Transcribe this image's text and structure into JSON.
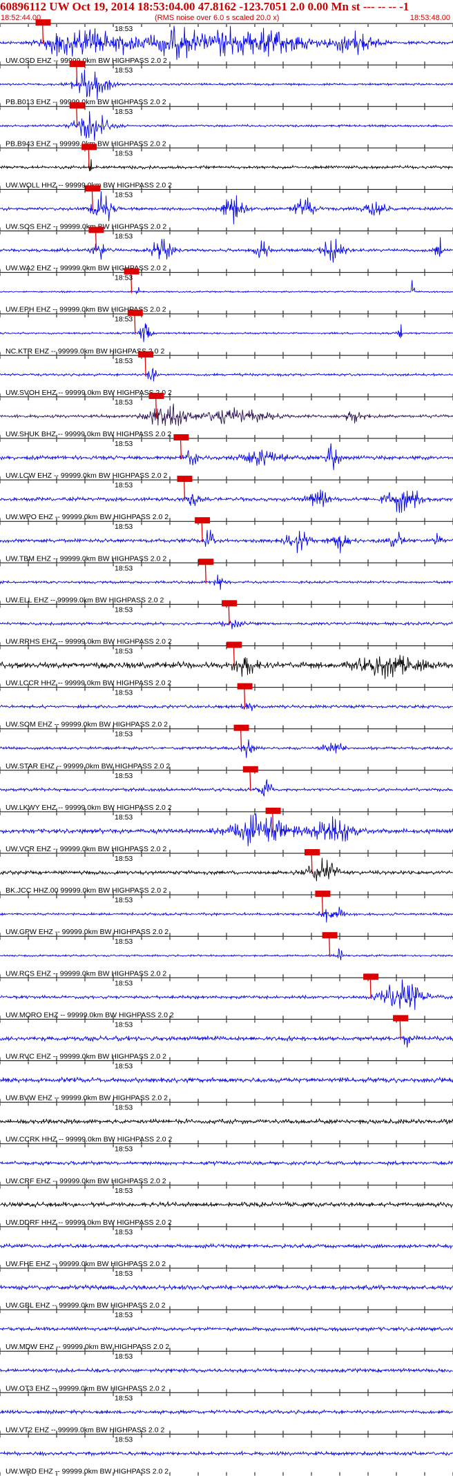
{
  "header": {
    "title": "60896112 UW Oct 19, 2014 18:53:04.00   47.8162 -123.7051  2.0 0.00 Mn st --- -- --   -1",
    "start_time": "18:52:44.00",
    "rms_note": "(RMS noise over 6.0 s scaled 20.0 x)",
    "end_time": "18:53:48.00"
  },
  "chart_data": {
    "type": "line",
    "x_start": "18:52:44.00",
    "x_end": "18:53:48.00",
    "x_range_seconds": [
      0,
      64
    ],
    "minute_tick_label": "18:53",
    "minute_tick_seconds": 16,
    "tick_interval_seconds": 4,
    "station_suffix": "99999.0km BW  HIGHPASS  2.0  2",
    "traces": [
      {
        "label": "UW.OSD EHZ -- 99999.0km BW  HIGHPASS  2.0  2",
        "color": "#0000ee",
        "pick_s": 6.0,
        "events": [
          [
            10,
            8,
            1.0
          ],
          [
            15,
            8,
            0.9
          ],
          [
            25,
            10,
            0.9
          ],
          [
            32,
            4,
            0.7
          ],
          [
            38,
            12,
            0.8
          ],
          [
            50,
            6,
            0.7
          ]
        ],
        "noise": 0.1
      },
      {
        "label": "PB.B013 EHZ -- 99999.0km BW  HIGHPASS  2.0  2",
        "color": "#0000ee",
        "pick_s": 10.8,
        "events": [
          [
            13,
            5,
            1.0
          ]
        ],
        "noise": 0.07
      },
      {
        "label": "PB.B943 EHZ -- 99999.0km BW  HIGHPASS  2.0  2",
        "color": "#0000ee",
        "pick_s": 10.8,
        "events": [
          [
            13,
            5,
            1.0
          ]
        ],
        "noise": 0.07
      },
      {
        "label": "UW.WOLL HHZ -- 99999.0km BW  HIGHPASS  2.0  2",
        "color": "#000000",
        "pick_s": 12.5,
        "events": [
          [
            12.7,
            0.6,
            0.6
          ]
        ],
        "noise": 0.1
      },
      {
        "label": "UW.SOS EHZ -- 99999.0km BW  HIGHPASS  2.0  2",
        "color": "#0000ee",
        "pick_s": 13.0,
        "events": [
          [
            14.5,
            3,
            0.9
          ],
          [
            33,
            3,
            0.9
          ],
          [
            43,
            3,
            0.8
          ],
          [
            53,
            3,
            0.6
          ]
        ],
        "noise": 0.1
      },
      {
        "label": "UW.WA2 EHZ -- 99999.0km BW  HIGHPASS  2.0  2",
        "color": "#0000ee",
        "pick_s": 13.5,
        "events": [
          [
            14,
            2,
            0.7
          ],
          [
            23,
            3,
            0.9
          ],
          [
            37,
            2,
            0.6
          ],
          [
            47,
            3,
            0.8
          ],
          [
            62,
            1,
            0.9
          ]
        ],
        "noise": 0.1
      },
      {
        "label": "UW.EPH EHZ -- 99999.0km BW  HIGHPASS  2.0  2",
        "color": "#0000ee",
        "pick_s": 18.5,
        "events": [
          [
            19.5,
            0.5,
            0.3
          ],
          [
            58.3,
            0.4,
            1.0
          ]
        ],
        "noise": 0.05
      },
      {
        "label": "NC.KTR EHZ -- 99999.0km BW  HIGHPASS  2.0  2",
        "color": "#0000ee",
        "pick_s": 19.0,
        "events": [
          [
            20.5,
            1.5,
            0.8
          ],
          [
            56.5,
            0.6,
            0.9
          ]
        ],
        "noise": 0.06
      },
      {
        "label": "UW.SVOH EHZ -- 99999.0km BW  HIGHPASS  2.0  2",
        "color": "#0000ee",
        "pick_s": 20.5,
        "events": [
          [
            21.5,
            1.5,
            0.5
          ]
        ],
        "noise": 0.08
      },
      {
        "label": "UW.SHUK BHZ -- 99999.0km BW  HIGHPASS  2.0  2",
        "color": "#2a1050",
        "pick_s": 22.0,
        "events": [
          [
            23.5,
            5,
            1.0
          ],
          [
            33,
            10,
            0.5
          ],
          [
            50,
            3,
            0.4
          ]
        ],
        "noise": 0.1
      },
      {
        "label": "UW.LCW EHZ -- 99999.0km BW  HIGHPASS  2.0  2",
        "color": "#0000ee",
        "pick_s": 25.5,
        "events": [
          [
            27,
            2,
            0.5
          ],
          [
            37,
            6,
            0.5
          ],
          [
            47,
            2,
            0.8
          ]
        ],
        "noise": 0.12
      },
      {
        "label": "UW.WPO EHZ -- 99999.0km BW  HIGHPASS  2.0  2",
        "color": "#0000ee",
        "pick_s": 26.0,
        "events": [
          [
            27,
            2,
            0.6
          ],
          [
            45,
            3,
            0.6
          ],
          [
            57,
            5,
            0.8
          ]
        ],
        "noise": 0.12
      },
      {
        "label": "UW.TBM EHZ -- 99999.0km BW  HIGHPASS  2.0  2",
        "color": "#0000ee",
        "pick_s": 28.5,
        "events": [
          [
            29.5,
            1.5,
            0.8
          ],
          [
            42,
            3,
            0.7
          ],
          [
            48,
            3,
            0.6
          ],
          [
            56,
            2,
            0.6
          ],
          [
            62,
            1,
            0.8
          ]
        ],
        "noise": 0.12
      },
      {
        "label": "UW.ELL EHZ -- 99999.0km BW  HIGHPASS  2.0  2",
        "color": "#0000ee",
        "pick_s": 29.0,
        "events": [
          [
            31,
            1.5,
            0.6
          ]
        ],
        "noise": 0.08
      },
      {
        "label": "UW.RRHS EHZ -- 99999.0km BW  HIGHPASS  2.0  2",
        "color": "#0000ee",
        "pick_s": 32.3,
        "events": [
          [
            33,
            3,
            0.3
          ]
        ],
        "noise": 0.09
      },
      {
        "label": "UW.LCCR HHZ -- 99999.0km BW  HIGHPASS  2.0  2",
        "color": "#000000",
        "pick_s": 33.0,
        "events": [
          [
            34.5,
            3,
            0.6
          ],
          [
            55,
            9,
            0.6
          ]
        ],
        "noise": 0.2
      },
      {
        "label": "UW.SOM EHZ -- 99999.0km BW  HIGHPASS  2.0  2",
        "color": "#0000ee",
        "pick_s": 34.5,
        "events": [
          [
            35,
            2,
            0.3
          ]
        ],
        "noise": 0.1
      },
      {
        "label": "UW.STAR EHZ -- 99999.0km BW  HIGHPASS  2.0  2",
        "color": "#0000ee",
        "pick_s": 34.0,
        "events": [
          [
            35,
            1.5,
            0.6
          ],
          [
            47,
            3,
            0.4
          ]
        ],
        "noise": 0.09
      },
      {
        "label": "UW.LKWY EHZ -- 99999.0km BW  HIGHPASS  2.0  2",
        "color": "#0000ee",
        "pick_s": 35.3,
        "events": [
          [
            37.5,
            2,
            0.7
          ]
        ],
        "noise": 0.1
      },
      {
        "label": "UW.VCR EHZ -- 99999.0km BW  HIGHPASS  2.0  2",
        "color": "#0000ee",
        "pick_s": 38.5,
        "events": [
          [
            37,
            8,
            1.0
          ],
          [
            47,
            6,
            0.8
          ]
        ],
        "noise": 0.15
      },
      {
        "label": "BK.JCC HHZ.00 99999.0km BW  HIGHPASS  2.0  2",
        "color": "#000000",
        "pick_s": 44.0,
        "events": [
          [
            45.5,
            4,
            1.0
          ]
        ],
        "noise": 0.12
      },
      {
        "label": "UW.GPW EHZ -- 99999.0km BW  HIGHPASS  2.0  2",
        "color": "#0000ee",
        "pick_s": 45.5,
        "events": [
          [
            47,
            3,
            0.8
          ]
        ],
        "noise": 0.08
      },
      {
        "label": "UW.RCS EHZ -- 99999.0km BW  HIGHPASS  2.0  2",
        "color": "#0000ee",
        "pick_s": 46.5,
        "events": [
          [
            48,
            1,
            0.4
          ]
        ],
        "noise": 0.06
      },
      {
        "label": "UW.MORO EHZ -- 99999.0km BW  HIGHPASS  2.0  2",
        "color": "#0000ee",
        "pick_s": 52.3,
        "events": [
          [
            57,
            6,
            1.0
          ]
        ],
        "noise": 0.1
      },
      {
        "label": "UW.RVC EHZ -- 99999.0km BW  HIGHPASS  2.0  2",
        "color": "#0000ee",
        "pick_s": 56.5,
        "events": [
          [
            57.5,
            1,
            0.4
          ]
        ],
        "noise": 0.15
      },
      {
        "label": "UW.BVW EHZ -- 99999.0km BW  HIGHPASS  2.0  2",
        "color": "#0000ee",
        "pick_s": null,
        "events": [],
        "noise": 0.15
      },
      {
        "label": "UW.CCRK HHZ -- 99999.0km BW  HIGHPASS  2.0  2",
        "color": "#000000",
        "pick_s": null,
        "events": [],
        "noise": 0.15
      },
      {
        "label": "UW.CRF EHZ -- 99999.0km BW  HIGHPASS  2.0  2",
        "color": "#0000ee",
        "pick_s": null,
        "events": [],
        "noise": 0.12
      },
      {
        "label": "UW.DDRF HHZ -- 99999.0km BW  HIGHPASS  2.0  2",
        "color": "#000000",
        "pick_s": null,
        "events": [],
        "noise": 0.15
      },
      {
        "label": "UW.FHE EHZ -- 99999.0km BW  HIGHPASS  2.0  2",
        "color": "#0000ee",
        "pick_s": null,
        "events": [],
        "noise": 0.12
      },
      {
        "label": "UW.GBL EHZ -- 99999.0km BW  HIGHPASS  2.0  2",
        "color": "#0000ee",
        "pick_s": null,
        "events": [],
        "noise": 0.15
      },
      {
        "label": "UW.MDW EHZ -- 99999.0km BW  HIGHPASS  2.0  2",
        "color": "#0000ee",
        "pick_s": null,
        "events": [],
        "noise": 0.12
      },
      {
        "label": "UW.OT3 EHZ -- 99999.0km BW  HIGHPASS  2.0  2",
        "color": "#0000ee",
        "pick_s": null,
        "events": [],
        "noise": 0.12
      },
      {
        "label": "UW.VT2 EHZ -- 99999.0km BW  HIGHPASS  2.0  2",
        "color": "#0000ee",
        "pick_s": null,
        "events": [],
        "noise": 0.12
      },
      {
        "label": "UW.WRD EHZ -- 99999.0km BW  HIGHPASS  2.0  2",
        "color": "#0000ee",
        "pick_s": null,
        "events": [],
        "noise": 0.12
      }
    ]
  }
}
